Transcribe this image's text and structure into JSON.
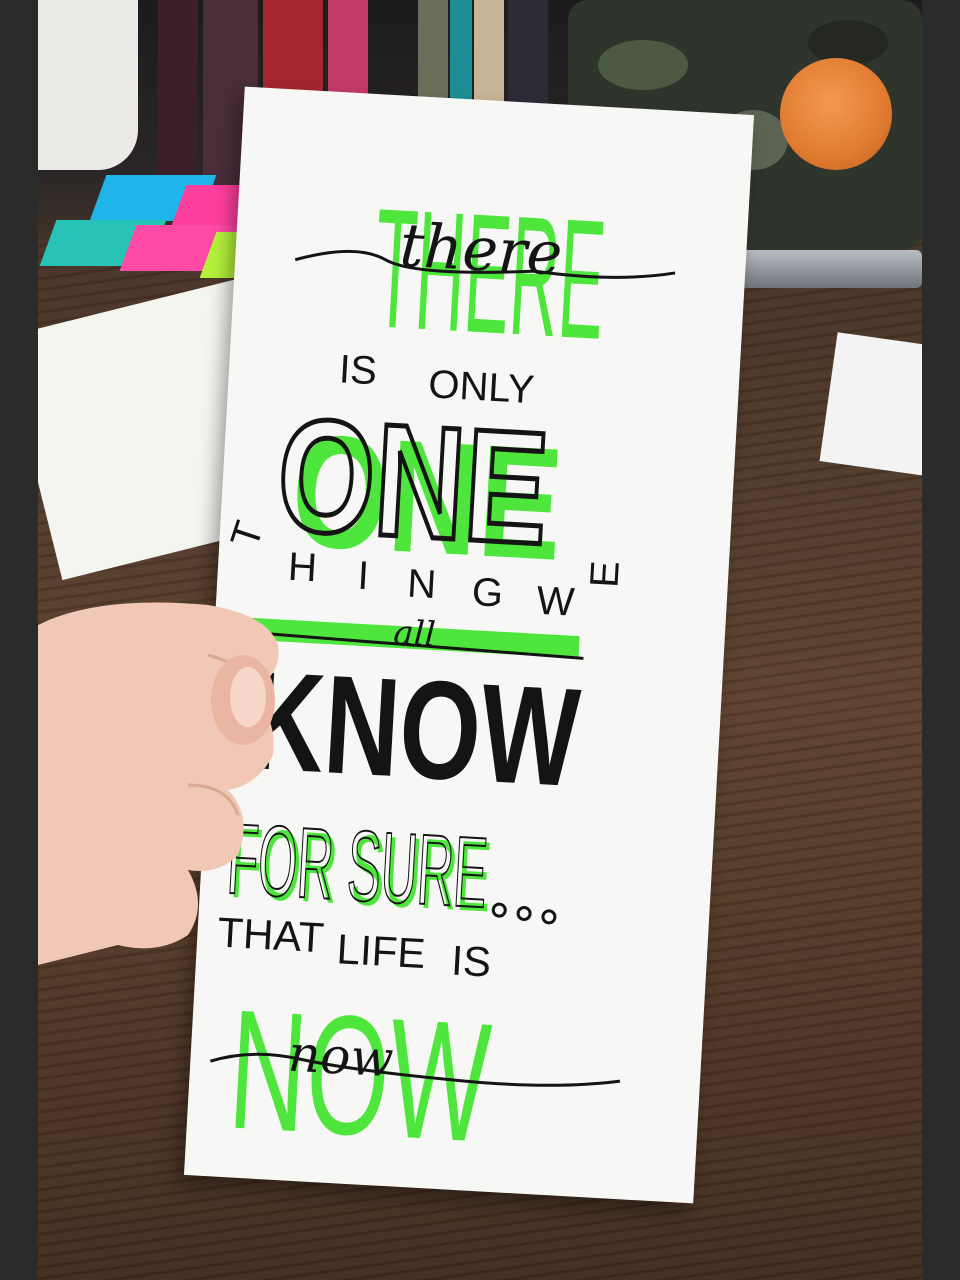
{
  "bookmark": {
    "line1_big": "THERE",
    "line1_script": "there",
    "line2": [
      "IS",
      "ONLY"
    ],
    "line3_big": "ONE",
    "line4_letters": [
      "T",
      "H",
      "I",
      "N",
      "G",
      "W",
      "E"
    ],
    "line5_script": "all",
    "line6_big": "KNOW",
    "line7_big": "FOR SURE",
    "line8": [
      "THAT",
      "LIFE",
      "IS"
    ],
    "line9_big": "NOW",
    "line9_script": "now"
  },
  "colors": {
    "highlighter_green": "#4ee63c",
    "ink": "#141414",
    "paper": "#f7f8f6"
  }
}
